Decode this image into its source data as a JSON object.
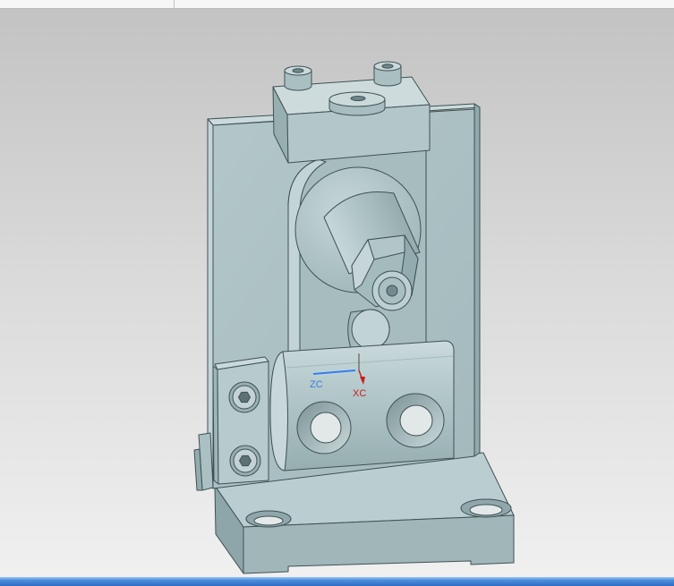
{
  "window": {
    "toolbar_background": "#f6f6f6",
    "taskbar_color": "#3f7fd2"
  },
  "viewport": {
    "background_top": "#c3c3c3",
    "background_bottom": "#f0f0f0"
  },
  "model": {
    "face_color": "#b0c5c8",
    "edge_color": "#3f5154"
  },
  "wcs": {
    "zc_label": "ZC",
    "zc_color": "#3b7ddb",
    "xc_label": "XC",
    "xc_color": "#cc1b1b"
  }
}
